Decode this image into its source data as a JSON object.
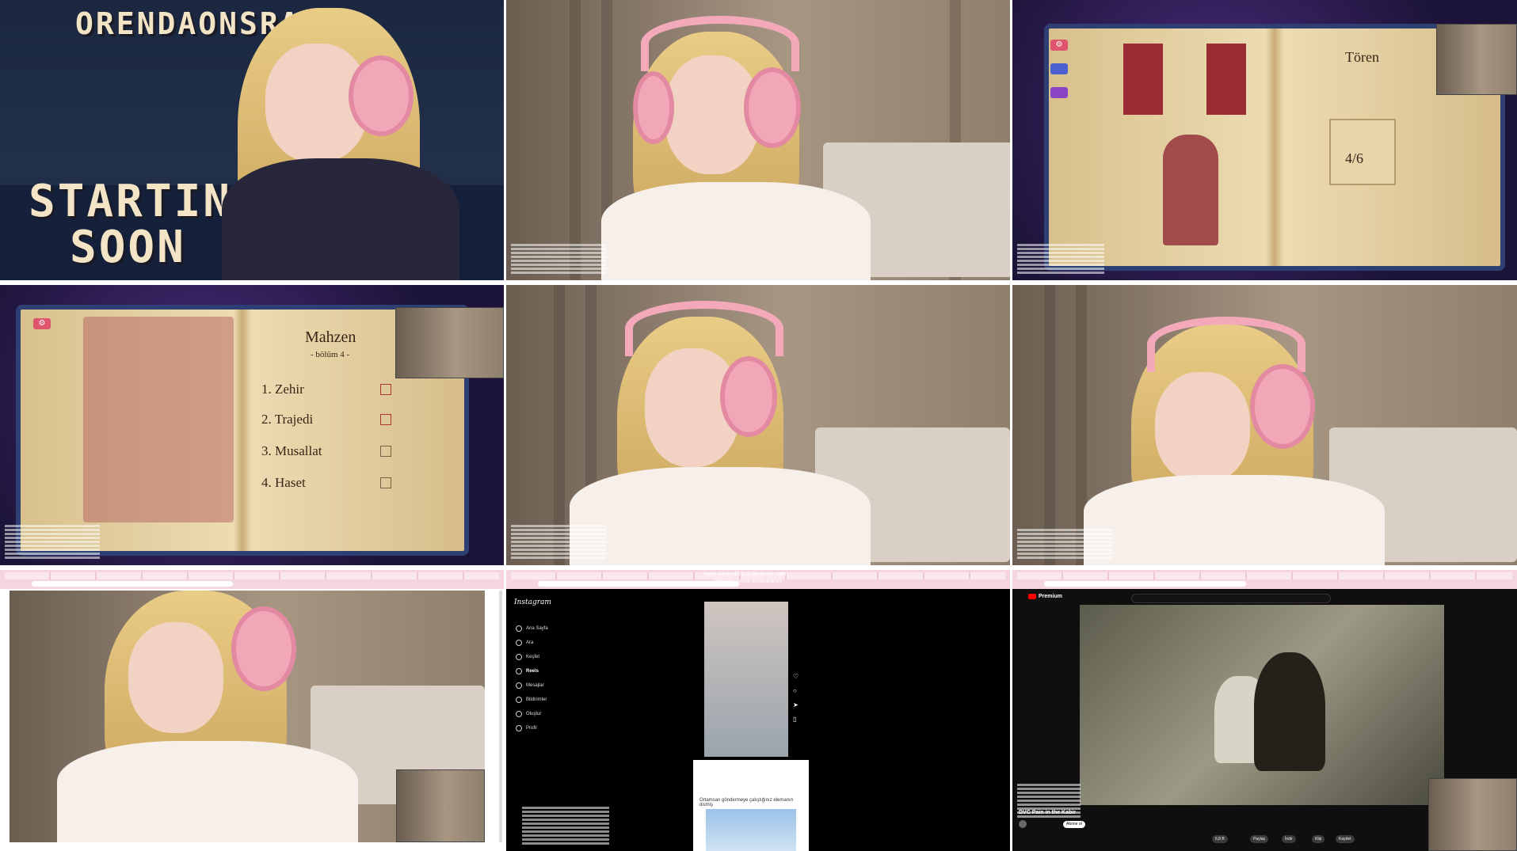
{
  "tile1": {
    "brand": "ORENDAONSRA",
    "line1": "STARTING",
    "line2": "SOON"
  },
  "tile3": {
    "page_title": "Tören",
    "counter": "4/6"
  },
  "tile4": {
    "title": "Mahzen",
    "subtitle": "- bölüm 4 -",
    "items": [
      "1. Zehir",
      "2. Trajedi",
      "3. Musallat",
      "4. Haset"
    ]
  },
  "tile8": {
    "brand": "Instagram",
    "nav": [
      "Ana Sayfa",
      "Ara",
      "Keşfet",
      "Reels",
      "Mesajlar",
      "Bildirimler",
      "Oluştur",
      "Profil"
    ],
    "caption_line1": "hayır kanka 6YZ değerim iyi zaten",
    "caption_line2": "dedikten sonra anlattıklarım",
    "second_post": "Ortamsan göndermeye çalıştığınız elemanın dismiş"
  },
  "tile9": {
    "logo": "Premium",
    "video_title": "DVC Pain in the Kabir",
    "subscribe": "Abone ol",
    "like": "6,8 B",
    "share": "Paylaş",
    "download": "İndir",
    "clip": "Klip",
    "save": "Kaydet"
  },
  "colors": {
    "headphone_pink": "#f2a7b8",
    "book_cover": "#2d3f73",
    "banner_red": "#9a2c34",
    "night_sky": "#1b2740"
  }
}
